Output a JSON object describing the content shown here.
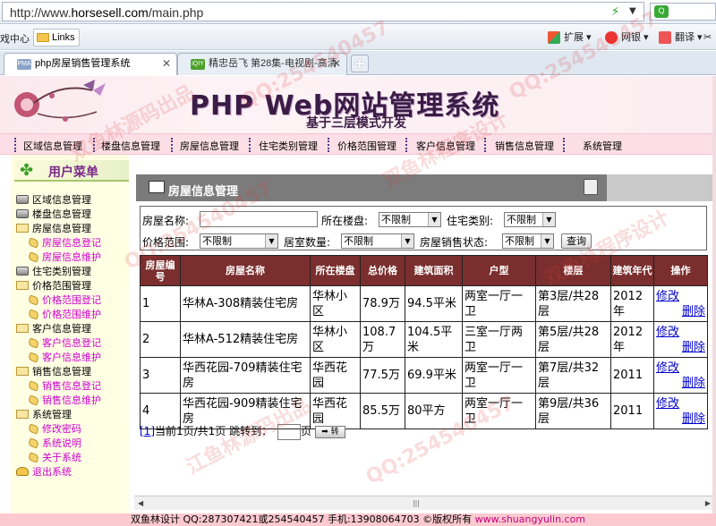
{
  "browser": {
    "url_prefix": "http://www.",
    "url_domain": "horsesell.com",
    "url_path": "/main.php",
    "bookmarks": {
      "left_text": "戏中心",
      "links_label": "Links",
      "extensions_label": "扩展",
      "bank_label": "网银",
      "translate_label": "翻译"
    },
    "tabs": [
      {
        "label": "php房屋销售管理系统",
        "favicon": "PMA",
        "active": true
      },
      {
        "label": "精忠岳飞 第28集-电视剧-高清",
        "favicon": "iQIY",
        "active": false
      }
    ]
  },
  "banner": {
    "title": "PHP Web网站管理系统",
    "subtitle": "基于三层模式开发"
  },
  "topnav": [
    "区域信息管理",
    "楼盘信息管理",
    "房屋信息管理",
    "住宅类别管理",
    "价格范围管理",
    "客户信息管理",
    "销售信息管理",
    "系统管理"
  ],
  "sidebar": {
    "header": "用户菜单",
    "items": [
      {
        "label": "区域信息管理",
        "type": "parent",
        "icon": "database-icon"
      },
      {
        "label": "楼盘信息管理",
        "type": "parent",
        "icon": "database-icon"
      },
      {
        "label": "房屋信息管理",
        "type": "parent",
        "icon": "folder-open-icon"
      },
      {
        "label": "房屋信息登记",
        "type": "child",
        "icon": "leaf-icon"
      },
      {
        "label": "房屋信息维护",
        "type": "child",
        "icon": "leaf-icon"
      },
      {
        "label": "住宅类别管理",
        "type": "parent",
        "icon": "database-icon"
      },
      {
        "label": "价格范围管理",
        "type": "parent",
        "icon": "folder-open-icon"
      },
      {
        "label": "价格范围登记",
        "type": "child",
        "icon": "leaf-icon"
      },
      {
        "label": "价格范围维护",
        "type": "child",
        "icon": "leaf-icon"
      },
      {
        "label": "客户信息管理",
        "type": "parent",
        "icon": "folder-open-icon"
      },
      {
        "label": "客户信息登记",
        "type": "child",
        "icon": "leaf-icon"
      },
      {
        "label": "客户信息维护",
        "type": "child",
        "icon": "leaf-icon"
      },
      {
        "label": "销售信息管理",
        "type": "parent",
        "icon": "folder-open-icon"
      },
      {
        "label": "销售信息登记",
        "type": "child",
        "icon": "leaf-icon"
      },
      {
        "label": "销售信息维护",
        "type": "child",
        "icon": "leaf-icon"
      },
      {
        "label": "系统管理",
        "type": "parent",
        "icon": "folder-open-icon"
      },
      {
        "label": "修改密码",
        "type": "child",
        "icon": "leaf-icon"
      },
      {
        "label": "系统说明",
        "type": "child",
        "icon": "leaf-icon"
      },
      {
        "label": "关于系统",
        "type": "child",
        "icon": "leaf-icon"
      },
      {
        "label": "退出系统",
        "type": "exit",
        "icon": "exit-icon"
      }
    ]
  },
  "main": {
    "title": "房屋信息管理",
    "filters": {
      "name_label": "房屋名称:",
      "name_value": "",
      "building_label": "所在楼盘:",
      "building_value": "不限制",
      "type_label": "住宅类别:",
      "type_value": "不限制",
      "price_label": "价格范围:",
      "price_value": "不限制",
      "rooms_label": "居室数量:",
      "rooms_value": "不限制",
      "status_label": "房屋销售状态:",
      "status_value": "不限制",
      "search_button": "查询"
    },
    "table": {
      "headers": [
        "房屋编号",
        "房屋名称",
        "所在楼盘",
        "总价格",
        "建筑面积",
        "户型",
        "楼层",
        "建筑年代",
        "操作"
      ],
      "rows": [
        {
          "id": "1",
          "name": "华林A-308精装住宅房",
          "building": "华林小区",
          "price": "78.9万",
          "area": "94.5平米",
          "layout": "两室一厅一卫",
          "floor": "第3层/共28层",
          "year": "2012年"
        },
        {
          "id": "2",
          "name": "华林A-512精装住宅房",
          "building": "华林小区",
          "price": "108.7万",
          "area": "104.5平米",
          "layout": "三室一厅两卫",
          "floor": "第5层/共28层",
          "year": "2012年"
        },
        {
          "id": "3",
          "name": "华西花园-709精装住宅房",
          "building": "华西花园",
          "price": "77.5万",
          "area": "69.9平米",
          "layout": "两室一厅一卫",
          "floor": "第7层/共32层",
          "year": "2011"
        },
        {
          "id": "4",
          "name": "华西花园-909精装住宅房",
          "building": "华西花园",
          "price": "85.5万",
          "area": "80平方",
          "layout": "两室一厅一卫",
          "floor": "第9层/共36层",
          "year": "2011"
        }
      ],
      "edit_label": "修改",
      "delete_label": "删除"
    },
    "pager": {
      "page_link": "[1]",
      "status": "当前1页/共1页 跳转到：",
      "page_unit": "页",
      "go_label": "➡ 转"
    }
  },
  "footer": {
    "text": "双鱼林设计 QQ:287307421或254540457 手机:13908064703 ©版权所有 ",
    "site": "www.shuangyulin.com"
  },
  "watermarks": [
    "QQ:254540457",
    "双鱼林源码出品",
    "QQ:254540457",
    "双鱼林程序设计",
    "QQ:254540457",
    "江鱼林源码出品",
    "QQ:254540457",
    "双鱼林程序设计"
  ],
  "colors": {
    "banner_bg": "#fbe9ee",
    "nav_bg": "#fcdfe6",
    "sidebar_bg": "#ffffe4",
    "table_header": "#7a2e2e",
    "child_link": "#cc00cc",
    "footer_bg": "#fbc9cf"
  }
}
